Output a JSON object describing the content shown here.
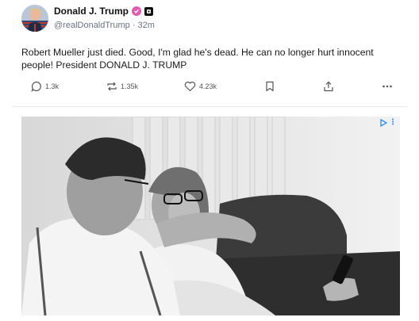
{
  "post": {
    "author": {
      "display_name": "Donald J. Trump",
      "handle": "@realDonaldTrump",
      "separator": "·",
      "time": "32m"
    },
    "text": "Robert Mueller just died. Good, I'm glad he's dead. He can no longer hurt innocent people! President DONALD J. TRUMP",
    "actions": {
      "replies": "1.3k",
      "reposts": "1.35k",
      "likes": "4.23k"
    }
  },
  "ad": {
    "badge_icon": "adchoices-icon",
    "badge_mark": "⋮"
  }
}
